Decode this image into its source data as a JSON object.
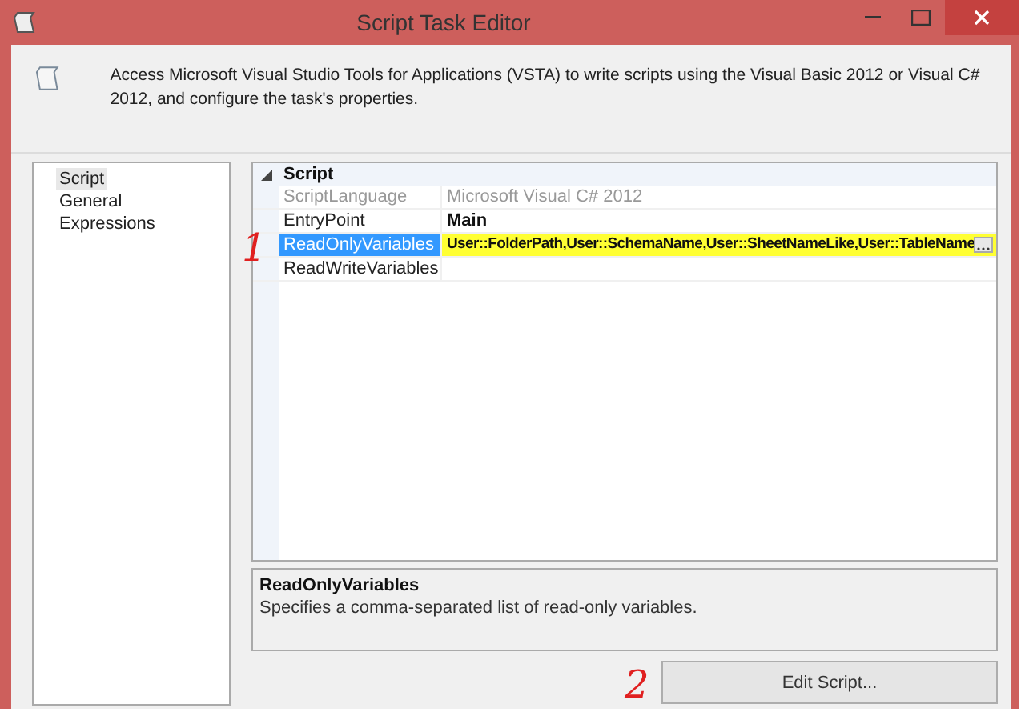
{
  "window": {
    "title": "Script Task Editor"
  },
  "header": {
    "text": "Access Microsoft Visual Studio Tools for Applications (VSTA) to write scripts using the Visual Basic 2012 or Visual C# 2012, and configure the task's properties."
  },
  "sidebar": {
    "items": [
      {
        "label": "Script",
        "selected": true
      },
      {
        "label": "General",
        "selected": false
      },
      {
        "label": "Expressions",
        "selected": false
      }
    ]
  },
  "property_grid": {
    "category": {
      "label": "Script",
      "expanded": true
    },
    "rows": [
      {
        "name": "ScriptLanguage",
        "value": "Microsoft Visual C# 2012",
        "disabled": true,
        "bold": false,
        "selected": false,
        "highlighted": false
      },
      {
        "name": "EntryPoint",
        "value": "Main",
        "disabled": false,
        "bold": true,
        "selected": false,
        "highlighted": false
      },
      {
        "name": "ReadOnlyVariables",
        "value": "User::FolderPath,User::SchemaName,User::SheetNameLike,User::TableName",
        "disabled": false,
        "bold": true,
        "selected": true,
        "highlighted": true
      },
      {
        "name": "ReadWriteVariables",
        "disabled": false,
        "selected": false,
        "highlighted": false
      }
    ]
  },
  "description": {
    "title": "ReadOnlyVariables",
    "text": "Specifies a comma-separated list of read-only variables."
  },
  "buttons": [
    {
      "label": "Edit Script..."
    }
  ],
  "annotations": [
    {
      "text": "1"
    },
    {
      "text": "2"
    }
  ]
}
